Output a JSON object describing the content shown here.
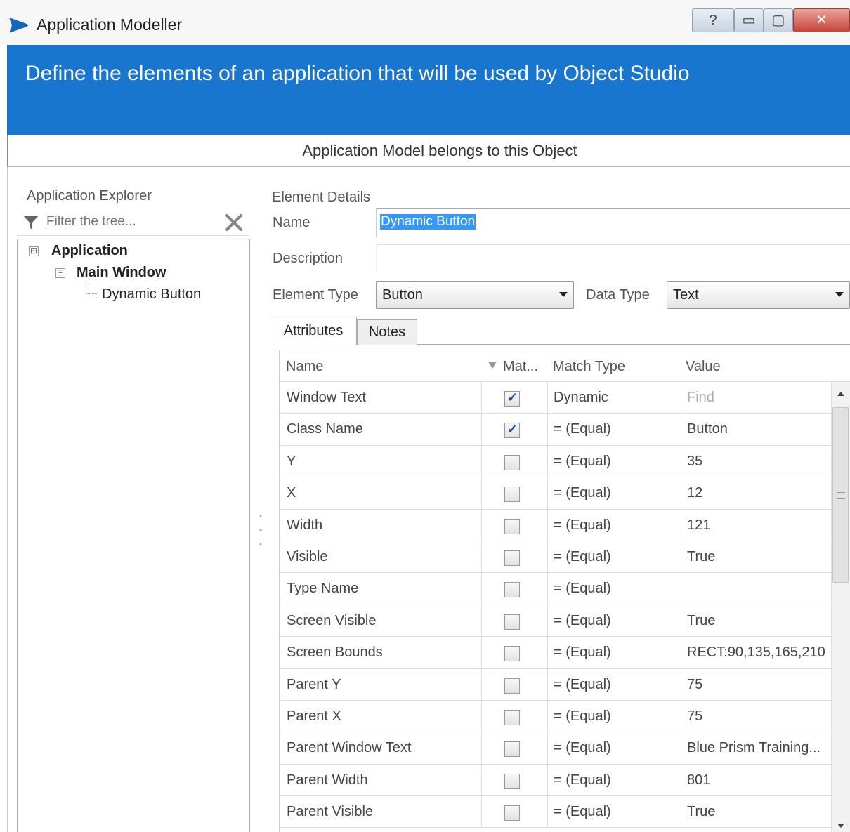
{
  "window": {
    "title": "Application Modeller",
    "icon": "blue-prism-logo-icon",
    "controls": {
      "help": "?",
      "minimize": "▭",
      "maximize": "▢",
      "close": "✕"
    }
  },
  "header": {
    "text": "Define the elements of an application that will be used by Object Studio"
  },
  "belongs_bar": {
    "text": "Application Model belongs to this Object"
  },
  "explorer": {
    "title": "Application Explorer",
    "filter_placeholder": "Filter the tree...",
    "tree": [
      {
        "label": "Application",
        "bold": true,
        "expander": "⊟"
      },
      {
        "label": "Main Window",
        "bold": true,
        "expander": "⊟"
      },
      {
        "label": "Dynamic Button",
        "bold": false
      }
    ]
  },
  "details": {
    "title": "Element Details",
    "name_label": "Name",
    "name_value": "Dynamic Button",
    "description_label": "Description",
    "element_type_label": "Element Type",
    "element_type_value": "Button",
    "data_type_label": "Data Type",
    "data_type_value": "Text"
  },
  "tabs": [
    {
      "label": "Attributes",
      "active": true
    },
    {
      "label": "Notes",
      "active": false
    }
  ],
  "grid": {
    "headers": {
      "name": "Name",
      "match": "Mat...",
      "match_type": "Match Type",
      "value": "Value"
    },
    "rows": [
      {
        "name": "Window Text",
        "match": true,
        "match_type": "Dynamic",
        "value": "Find",
        "value_muted": true
      },
      {
        "name": "Class Name",
        "match": true,
        "match_type": "= (Equal)",
        "value": "Button"
      },
      {
        "name": "Y",
        "match": false,
        "match_type": "= (Equal)",
        "value": "35"
      },
      {
        "name": "X",
        "match": false,
        "match_type": "= (Equal)",
        "value": "12"
      },
      {
        "name": "Width",
        "match": false,
        "match_type": "= (Equal)",
        "value": "121"
      },
      {
        "name": "Visible",
        "match": false,
        "match_type": "= (Equal)",
        "value": "True"
      },
      {
        "name": "Type Name",
        "match": false,
        "match_type": "= (Equal)",
        "value": ""
      },
      {
        "name": "Screen Visible",
        "match": false,
        "match_type": "= (Equal)",
        "value": "True"
      },
      {
        "name": "Screen Bounds",
        "match": false,
        "match_type": "= (Equal)",
        "value": "RECT:90,135,165,210"
      },
      {
        "name": "Parent Y",
        "match": false,
        "match_type": "= (Equal)",
        "value": "75"
      },
      {
        "name": "Parent X",
        "match": false,
        "match_type": "= (Equal)",
        "value": "75"
      },
      {
        "name": "Parent Window Text",
        "match": false,
        "match_type": "= (Equal)",
        "value": "Blue Prism Training..."
      },
      {
        "name": "Parent Width",
        "match": false,
        "match_type": "= (Equal)",
        "value": "801"
      },
      {
        "name": "Parent Visible",
        "match": false,
        "match_type": "= (Equal)",
        "value": "True"
      }
    ]
  },
  "colors": {
    "header_bg": "#1976cf",
    "selection": "#3399ff",
    "close_button": "#c8433a"
  }
}
